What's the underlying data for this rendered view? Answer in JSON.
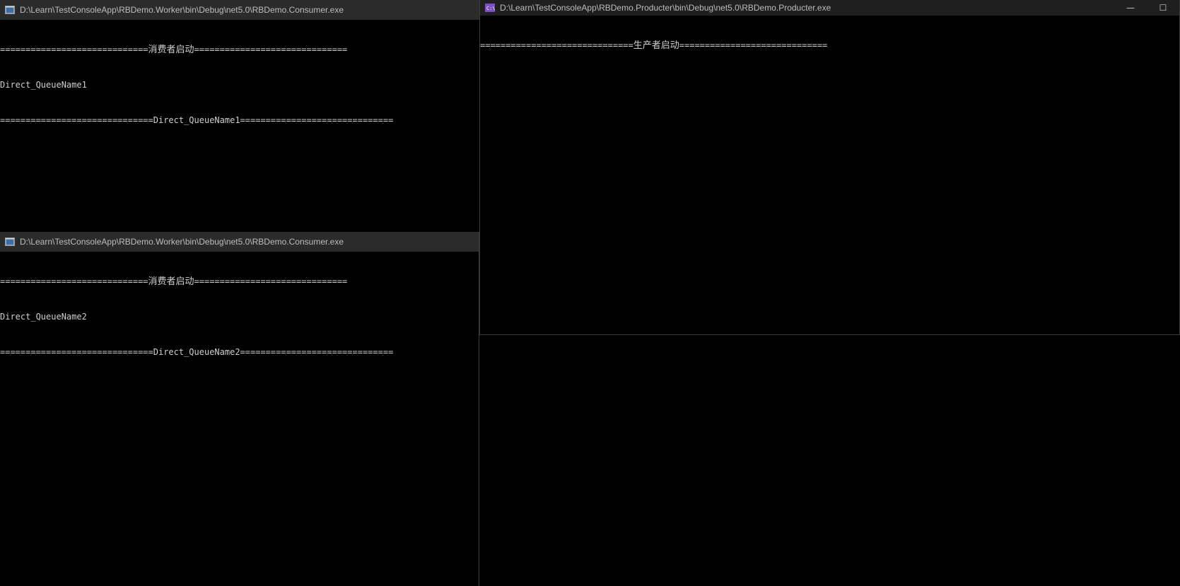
{
  "windows": {
    "consumer1": {
      "title": "D:\\Learn\\TestConsoleApp\\RBDemo.Worker\\bin\\Debug\\net5.0\\RBDemo.Consumer.exe",
      "lines": [
        {
          "pre": "=============================",
          "cjk": "消费者启动",
          "post": "=============================="
        },
        {
          "pre": "Direct_QueueName1",
          "cjk": "",
          "post": ""
        },
        {
          "pre": "==============================Direct_QueueName1==============================",
          "cjk": "",
          "post": ""
        }
      ]
    },
    "consumer2": {
      "title": "D:\\Learn\\TestConsoleApp\\RBDemo.Worker\\bin\\Debug\\net5.0\\RBDemo.Consumer.exe",
      "lines": [
        {
          "pre": "=============================",
          "cjk": "消费者启动",
          "post": "=============================="
        },
        {
          "pre": "Direct_QueueName2",
          "cjk": "",
          "post": ""
        },
        {
          "pre": "==============================Direct_QueueName2==============================",
          "cjk": "",
          "post": ""
        }
      ]
    },
    "producer": {
      "title": "D:\\Learn\\TestConsoleApp\\RBDemo.Producter\\bin\\Debug\\net5.0\\RBDemo.Producter.exe",
      "lines": [
        {
          "pre": "==============================",
          "cjk": "生产者启动",
          "post": "============================="
        }
      ],
      "buttons": {
        "minimize": "—",
        "maximize": "☐"
      }
    }
  },
  "icons": {
    "console": "console-window-icon",
    "producer": "cmd-prompt-icon"
  },
  "colors": {
    "titlebar": "#2b2b2b",
    "producer_titlebar": "#1f1f1f",
    "console_bg": "#000000",
    "console_text": "#cfcfcf",
    "cmd_icon": "#7a4fc2"
  }
}
